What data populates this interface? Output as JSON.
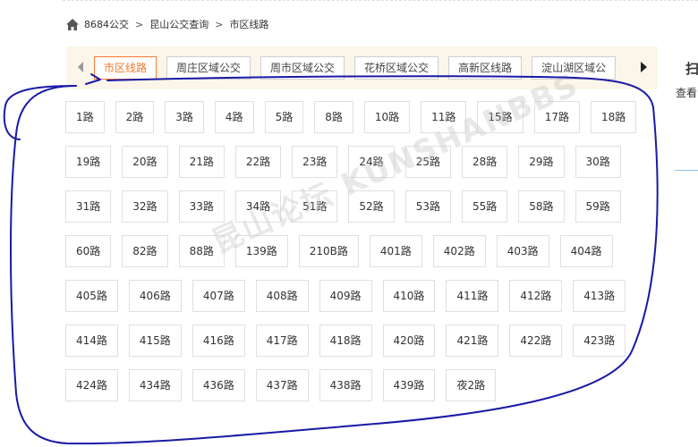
{
  "breadcrumb": {
    "home_icon": "home-icon",
    "items": [
      "8684公交",
      "昆山公交查询",
      "市区线路"
    ],
    "separator": ">"
  },
  "tabs": [
    {
      "label": "市区线路",
      "active": true
    },
    {
      "label": "周庄区域公交",
      "active": false
    },
    {
      "label": "周市区域公交",
      "active": false
    },
    {
      "label": "花桥区域公交",
      "active": false
    },
    {
      "label": "高新区线路",
      "active": false
    },
    {
      "label": "淀山湖区域公",
      "active": false
    }
  ],
  "sidebar": {
    "title": "扫",
    "subtitle": "查看"
  },
  "routes": [
    [
      "1路",
      "2路",
      "3路",
      "4路",
      "5路",
      "8路",
      "10路",
      "11路",
      "15路",
      "17路",
      "18路"
    ],
    [
      "19路",
      "20路",
      "21路",
      "22路",
      "23路",
      "24路",
      "25路",
      "28路",
      "29路",
      "30路"
    ],
    [
      "31路",
      "32路",
      "33路",
      "34路",
      "51路",
      "52路",
      "53路",
      "55路",
      "58路",
      "59路"
    ],
    [
      "60路",
      "82路",
      "88路",
      "139路",
      "210B路",
      "401路",
      "402路",
      "403路",
      "404路"
    ],
    [
      "405路",
      "406路",
      "407路",
      "408路",
      "409路",
      "410路",
      "411路",
      "412路",
      "413路"
    ],
    [
      "414路",
      "415路",
      "416路",
      "417路",
      "418路",
      "420路",
      "421路",
      "422路",
      "423路"
    ],
    [
      "424路",
      "434路",
      "436路",
      "437路",
      "438路",
      "439路",
      "夜2路"
    ]
  ],
  "watermark": "昆山论坛 KUNSHANBBS",
  "colors": {
    "accent": "#f47b3a",
    "tabbar_bg": "#fbf6e9",
    "annotation_stroke": "#1a1aa6"
  }
}
